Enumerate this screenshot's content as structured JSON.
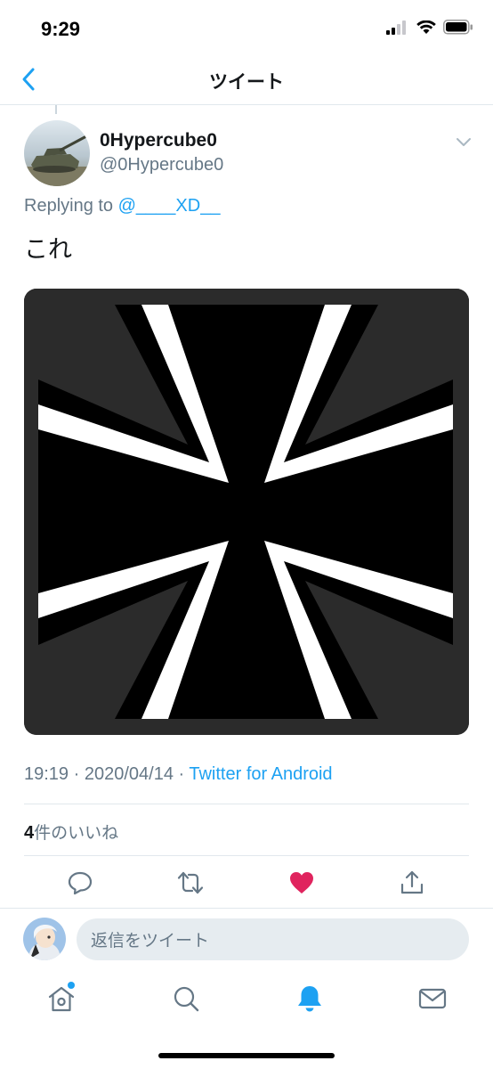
{
  "status_bar": {
    "time": "9:29"
  },
  "nav": {
    "title": "ツイート"
  },
  "tweet": {
    "display_name": "0Hypercube0",
    "handle": "@0Hypercube0",
    "replying_prefix": "Replying to ",
    "replying_to": "@____XD__",
    "text": "これ",
    "time": "19:19",
    "separator1": " · ",
    "date": "2020/04/14",
    "separator2": " · ",
    "source": "Twitter for Android",
    "likes_count": "4",
    "likes_suffix": "件のいいね"
  },
  "actions": [
    "reply-icon",
    "retweet-icon",
    "like-icon",
    "share-icon"
  ],
  "reply_bar": {
    "placeholder": "返信をツイート"
  },
  "tab_bar": [
    "home-icon",
    "search-icon",
    "notifications-icon",
    "messages-icon"
  ],
  "colors": {
    "accent": "#1da1f2",
    "like": "#e0245e",
    "secondary_text": "#657786",
    "divider": "#e1e8ed"
  }
}
